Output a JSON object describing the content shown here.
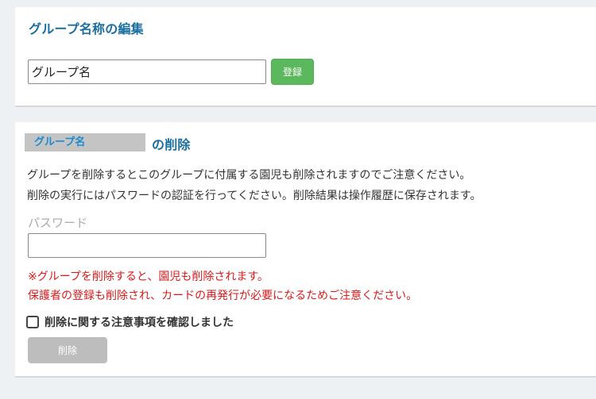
{
  "edit_section": {
    "title": "グループ名称の編集",
    "group_name_value": "グループ名",
    "register_label": "登録"
  },
  "delete_section": {
    "group_name_badge": "グループ名",
    "title_suffix": "の削除",
    "description_line1": "グループを削除するとこのグループに付属する園児も削除されますのでご注意ください。",
    "description_line2": "削除の実行にはパスワードの認証を行ってください。削除結果は操作履歴に保存されます。",
    "password_label": "パスワード",
    "password_value": "",
    "warning_line1": "※グループを削除すると、園児も削除されます。",
    "warning_line2": "保護者の登録も削除され、カードの再発行が必要になるためご注意ください。",
    "confirm_label": "削除に関する注意事項を確認しました",
    "confirm_checked": false,
    "delete_label": "削除"
  },
  "colors": {
    "title": "#1b6fa0",
    "register_button": "#5cb85c",
    "warning_text": "#d71a1a",
    "disabled_button": "#bdbdbd",
    "badge_background": "#c4c4c4",
    "badge_text": "#1b8bcf"
  }
}
